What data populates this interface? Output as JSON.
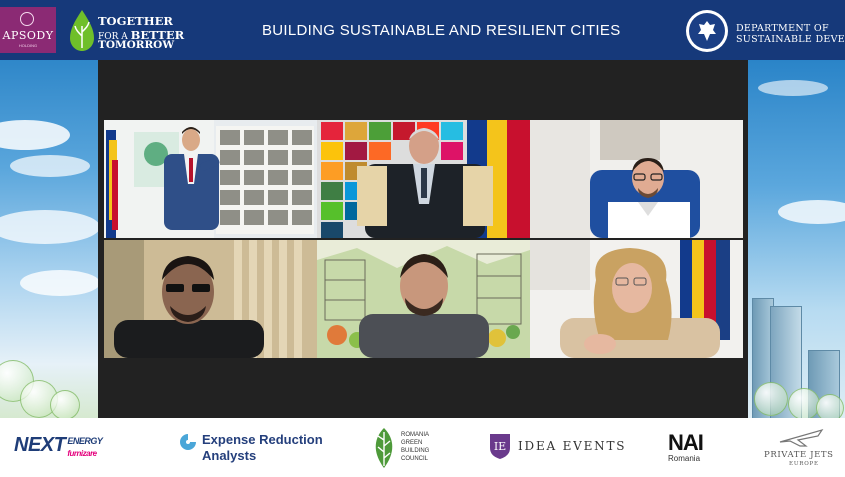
{
  "header": {
    "rhapsody_logo": {
      "name": "APSODY",
      "tagline": "HOLDING"
    },
    "together_logo": {
      "line1": "TOGETHER",
      "line2_small": "FOR A",
      "line2_big": "BETTER",
      "line3": "TOMORROW"
    },
    "title": "BUILDING SUSTAINABLE AND RESILIENT CITIES",
    "department": {
      "line1": "DEPARTMENT OF",
      "line2": "SUSTAINABLE DEVELOPM"
    }
  },
  "participants": [
    {
      "tile": "presenter-with-boards"
    },
    {
      "tile": "speaker-sdg-wall"
    },
    {
      "tile": "speaker-blue-chair"
    },
    {
      "tile": "speaker-blinds"
    },
    {
      "tile": "speaker-sketch-background"
    },
    {
      "tile": "speaker-flags"
    }
  ],
  "sponsors": {
    "next": {
      "main": "NEXT",
      "energy": "ENERGY",
      "sub": "furnizare"
    },
    "era": {
      "line1": "Expense Reduction",
      "line2": "Analysts"
    },
    "rgbc": {
      "line1": "ROMANIA",
      "line2": "GREEN",
      "line3": "BUILDING",
      "line4": "COUNCIL"
    },
    "idea": {
      "label": "IDEA EVENTS"
    },
    "nai": {
      "label": "NAI",
      "sub": "Romania"
    },
    "jets": {
      "line1": "PRIVATE JETS",
      "line2": "EUROPE"
    }
  },
  "colors": {
    "header_bg": "#16397a",
    "video_bg": "#222222",
    "rhapsody": "#8b2a74",
    "together_green": "#6fbf2a"
  }
}
